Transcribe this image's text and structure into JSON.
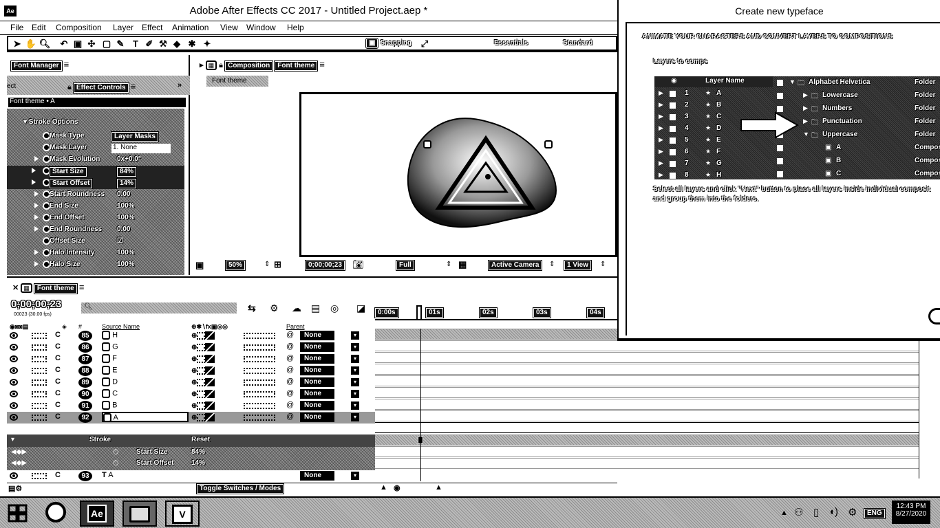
{
  "app": {
    "logo_text": "Ae",
    "title": "Adobe After Effects CC 2017 - Untitled Project.aep *"
  },
  "menu": [
    "File",
    "Edit",
    "Composition",
    "Layer",
    "Effect",
    "Animation",
    "View",
    "Window",
    "Help"
  ],
  "toolbar": {
    "snapping_label": "Snapping",
    "workspaces": [
      "Essentials",
      "Standard"
    ]
  },
  "font_manager": {
    "tab_label": "Font Manager"
  },
  "effect_controls": {
    "tab_label": "Effect Controls",
    "layer_path": "Font theme • A",
    "params": [
      {
        "name": "Mask Type",
        "value": "Layer Masks"
      },
      {
        "name": "Mask Layer",
        "value": "1. None"
      },
      {
        "name": "Mask Evolution",
        "value": "0x+0.0°"
      },
      {
        "name": "Start Size",
        "value": "84%"
      },
      {
        "name": "Start Offset",
        "value": "14%"
      },
      {
        "name": "Start Roundness",
        "value": "0.00"
      },
      {
        "name": "End Size",
        "value": "100%"
      },
      {
        "name": "End Offset",
        "value": "100%"
      },
      {
        "name": "End Roundness",
        "value": "0.00"
      },
      {
        "name": "Offset Size",
        "value": "☑"
      },
      {
        "name": "Halo Intensity",
        "value": "100%"
      },
      {
        "name": "Halo Size",
        "value": "100%"
      }
    ]
  },
  "composition": {
    "tab_label": "Composition",
    "comp_name": "Font theme",
    "breadcrumb": "Font theme",
    "footer": {
      "zoom": "50%",
      "timecode": "0;00;00;23",
      "resolution": "Full",
      "camera": "Active Camera",
      "views": "1 View"
    }
  },
  "timeline": {
    "tab_label": "Font theme",
    "timecode": "0;00;00;23",
    "timecode_sub": "00023 (30.00 fps)",
    "search_placeholder": "",
    "col_source_name": "Source Name",
    "col_parent": "Parent",
    "ruler": [
      "0:00s",
      "01s",
      "02s",
      "03s",
      "04s"
    ],
    "layers": [
      {
        "num": "85",
        "name": "H",
        "parent": "None"
      },
      {
        "num": "86",
        "name": "G",
        "parent": "None"
      },
      {
        "num": "87",
        "name": "F",
        "parent": "None"
      },
      {
        "num": "88",
        "name": "E",
        "parent": "None"
      },
      {
        "num": "89",
        "name": "D",
        "parent": "None"
      },
      {
        "num": "90",
        "name": "C",
        "parent": "None"
      },
      {
        "num": "91",
        "name": "B",
        "parent": "None"
      },
      {
        "num": "92",
        "name": "A",
        "parent": "None"
      }
    ],
    "sub_props": {
      "group": "Stroke",
      "group_value": "Reset",
      "p1": "Start Size",
      "p1_val": "84%",
      "p2": "Start Offset",
      "p2_val": "14%"
    },
    "last_layer": {
      "num": "93",
      "name": "A",
      "parent": "None"
    },
    "toggle_label": "Toggle Switches / Modes"
  },
  "typeface_window": {
    "title": "Create new typeface",
    "heading": "ANIMATE YOUR CHARACTERS AND CONVERT LAYERS TO COMPOSITIONS",
    "subheading": "Layers to comps",
    "col_layer_name": "Layer Name",
    "layer_rows": [
      "1",
      "2",
      "3",
      "4",
      "5",
      "6",
      "7",
      "8"
    ],
    "layer_letters": [
      "A",
      "B",
      "C",
      "D",
      "E",
      "F",
      "G",
      "H"
    ],
    "tree": [
      {
        "name": "Alphabet Helvetica",
        "type": "Folder",
        "indent": 0
      },
      {
        "name": "Lowercase",
        "type": "Folder",
        "indent": 1
      },
      {
        "name": "Numbers",
        "type": "Folder",
        "indent": 1
      },
      {
        "name": "Punctuation",
        "type": "Folder",
        "indent": 1
      },
      {
        "name": "Uppercase",
        "type": "Folder",
        "indent": 1
      },
      {
        "name": "A",
        "type": "Compos",
        "indent": 2
      },
      {
        "name": "B",
        "type": "Compos",
        "indent": 2
      },
      {
        "name": "C",
        "type": "Compos",
        "indent": 2
      }
    ],
    "instructions_line1": "Select all layers and click \"Next\" button to place all layers inside individual composit",
    "instructions_line2": "and group them into the folders."
  },
  "taskbar": {
    "lang": "ENG",
    "time": "12:43 PM",
    "date": "8/27/2020",
    "apps": [
      "start-icon",
      "cortana-icon",
      "after-effects-icon",
      "file-explorer-icon",
      "vivaldi-icon"
    ]
  }
}
